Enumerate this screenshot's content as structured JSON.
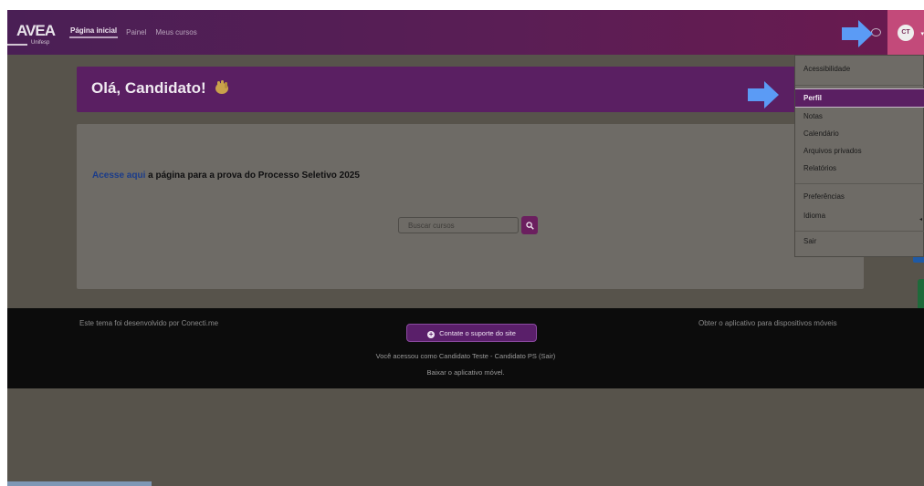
{
  "brand": {
    "logo_text": "AVEA",
    "logo_sub": "Unifesp"
  },
  "nav": {
    "links": [
      "Página inicial",
      "Painel",
      "Meus cursos"
    ]
  },
  "user": {
    "initials": "CT"
  },
  "welcome": {
    "greeting": "Olá, Candidato!"
  },
  "main": {
    "link_text": "Acesse aqui",
    "sentence": " a página para a prova do Processo Seletivo 2025",
    "search_placeholder": "Buscar cursos"
  },
  "footer": {
    "theme_credit": "Este tema foi desenvolvido por Conecti.me",
    "support_label": "Contate o suporte do site",
    "mobile_app": "Obter o aplicativo para dispositivos móveis",
    "logged_in_as": "Você acessou como Candidato Teste - Candidato PS (Sair)",
    "download_app": "Baixar o aplicativo móvel."
  },
  "user_menu": {
    "items": [
      "Acessibilidade",
      "Perfil",
      "Notas",
      "Calendário",
      "Arquivos privados",
      "Relatórios",
      "Preferências",
      "Idioma",
      "Sair"
    ],
    "active_index": 1
  },
  "colors": {
    "navbar": "#4a1f55",
    "accent_pink": "#c34a7a",
    "welcome_banner": "#5a1f62",
    "pointer_arrow": "#5b9bf5"
  },
  "icons": [
    "chat-icon",
    "pointer-arrow-icon",
    "waving-hand-icon",
    "search-icon",
    "plus-circle-icon",
    "chevron-down-icon"
  ]
}
